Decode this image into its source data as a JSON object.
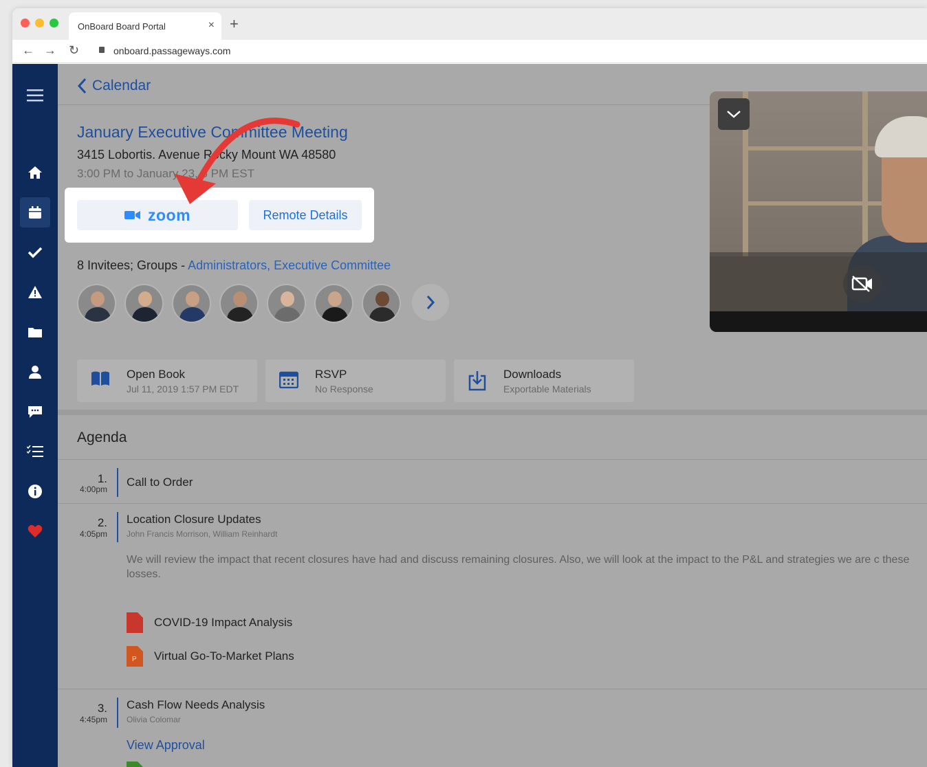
{
  "browser": {
    "tab_title": "OnBoard Board Portal",
    "tab_close": "×",
    "new_tab": "+",
    "url": "onboard.passageways.com"
  },
  "back": {
    "label": "Calendar"
  },
  "meeting": {
    "title": "January Executive Committee Meeting",
    "address": "3415 Lobortis. Avenue Rocky Mount WA 48580",
    "time": "3:00 PM to January 23, 5 PM EST"
  },
  "actions": {
    "zoom_label": "zoom",
    "remote_label": "Remote Details"
  },
  "invitees": {
    "prefix": "8 Invitees; Groups - ",
    "groups": "Administrators, Executive Committee"
  },
  "cards": [
    {
      "title": "Open Book",
      "sub": "Jul 11, 2019 1:57 PM EDT",
      "icon": "book-icon"
    },
    {
      "title": "RSVP",
      "sub": "No Response",
      "icon": "calendar-icon"
    },
    {
      "title": "Downloads",
      "sub": "Exportable Materials",
      "icon": "download-icon"
    }
  ],
  "agenda": {
    "title": "Agenda",
    "items": [
      {
        "num": "1.",
        "time": "4:00pm",
        "title": "Call to Order"
      },
      {
        "num": "2.",
        "time": "4:05pm",
        "title": "Location Closure Updates",
        "people": "John Francis Morrison, William Reinhardt",
        "desc": "We will review the impact that recent closures have had and discuss remaining closures. Also, we will look at the impact to the P&L and strategies we are c these losses."
      },
      {
        "num": "3.",
        "time": "4:45pm",
        "title": "Cash Flow Needs Analysis",
        "people": "Olivia Colomar",
        "link": "View Approval"
      }
    ],
    "docs": [
      {
        "name": "COVID-19 Impact Analysis",
        "icon": "pdf-file-icon",
        "color": "#c9372c"
      },
      {
        "name": "Virtual Go-To-Market Plans",
        "icon": "ppt-file-icon",
        "color": "#d2561f",
        "badge": "P"
      }
    ]
  },
  "colors": {
    "sidebar": "#0d2a5a",
    "accent": "#1f4e9c",
    "zoom": "#2d8cff",
    "arrow": "#e53935",
    "heart": "#e02b2b"
  }
}
